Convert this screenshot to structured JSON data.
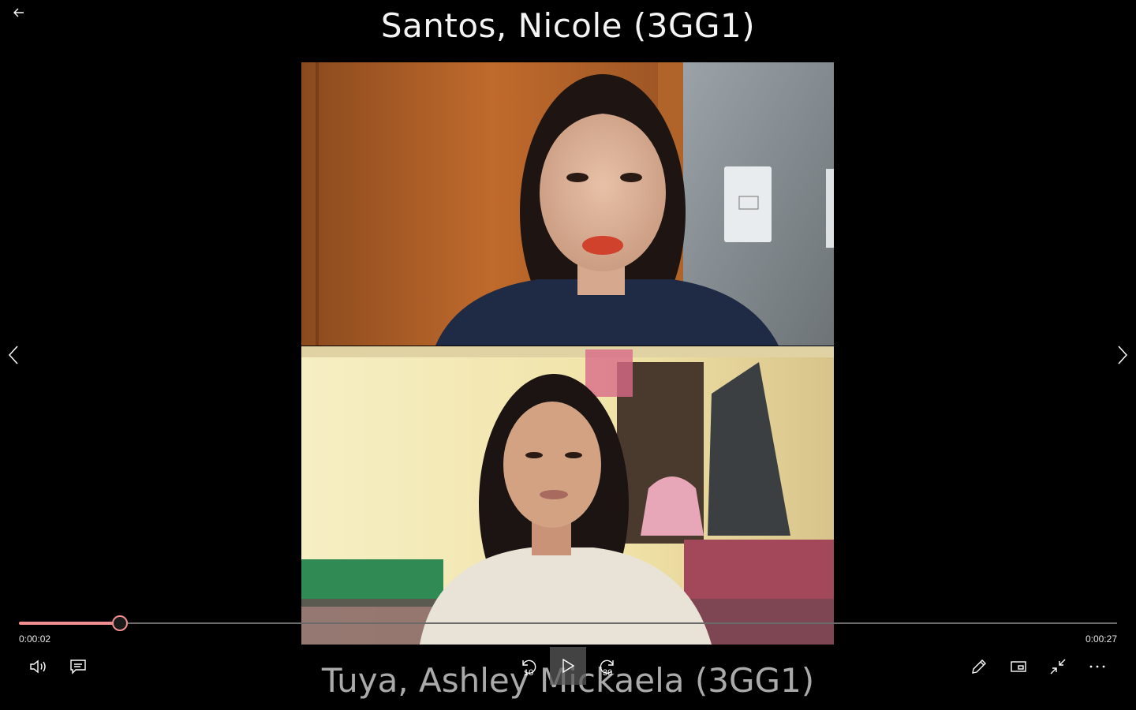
{
  "player": {
    "caption_top": "Santos, Nicole (3GG1)",
    "caption_bottom": "Tuya, Ashley Mickaela (3GG1)",
    "time_elapsed": "0:00:02",
    "time_total": "0:00:27",
    "progress_fraction": 0.092,
    "skip_back_seconds": "10",
    "skip_forward_seconds": "30"
  },
  "colors": {
    "accent": "#f08e90",
    "background": "#000000"
  },
  "icons": {
    "back": "arrow-left-icon",
    "prev": "chevron-left-icon",
    "next": "chevron-right-icon",
    "volume": "volume-icon",
    "subtitles": "subtitles-icon",
    "skip_back": "skip-back-10-icon",
    "play": "play-icon",
    "skip_forward": "skip-forward-30-icon",
    "edit": "pencil-icon",
    "mini_view": "mini-view-icon",
    "exit_fullscreen": "exit-fullscreen-icon",
    "more": "more-icon"
  }
}
